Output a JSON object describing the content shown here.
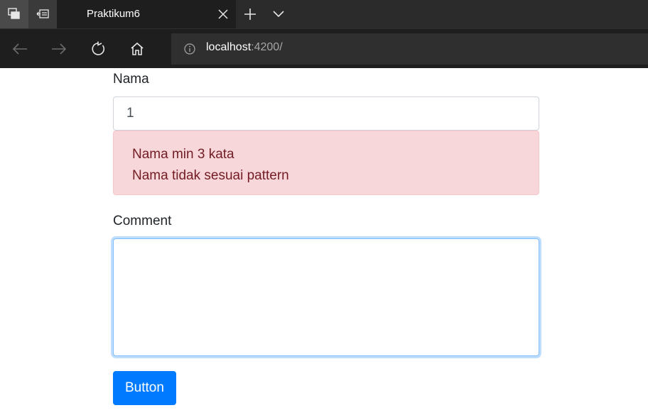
{
  "browser": {
    "tab_title": "Praktikum6",
    "url_host": "localhost",
    "url_port": ":4200/",
    "icons": {
      "tab_manager": "tab-manager-icon",
      "set_aside": "set-aside-icon",
      "close": "close-icon",
      "new_tab": "plus-icon",
      "tab_menu": "chevron-down-icon",
      "back": "arrow-left-icon",
      "forward": "arrow-right-icon",
      "refresh": "refresh-icon",
      "home": "home-icon",
      "info": "info-icon"
    }
  },
  "form": {
    "nama_label": "Nama",
    "nama_value": "1",
    "errors": [
      "Nama min 3 kata",
      "Nama tidak sesuai pattern"
    ],
    "comment_label": "Comment",
    "comment_value": "",
    "button_label": "Button"
  },
  "colors": {
    "primary": "#007bff",
    "alert_bg": "#f8d7da",
    "alert_text": "#721c24"
  }
}
